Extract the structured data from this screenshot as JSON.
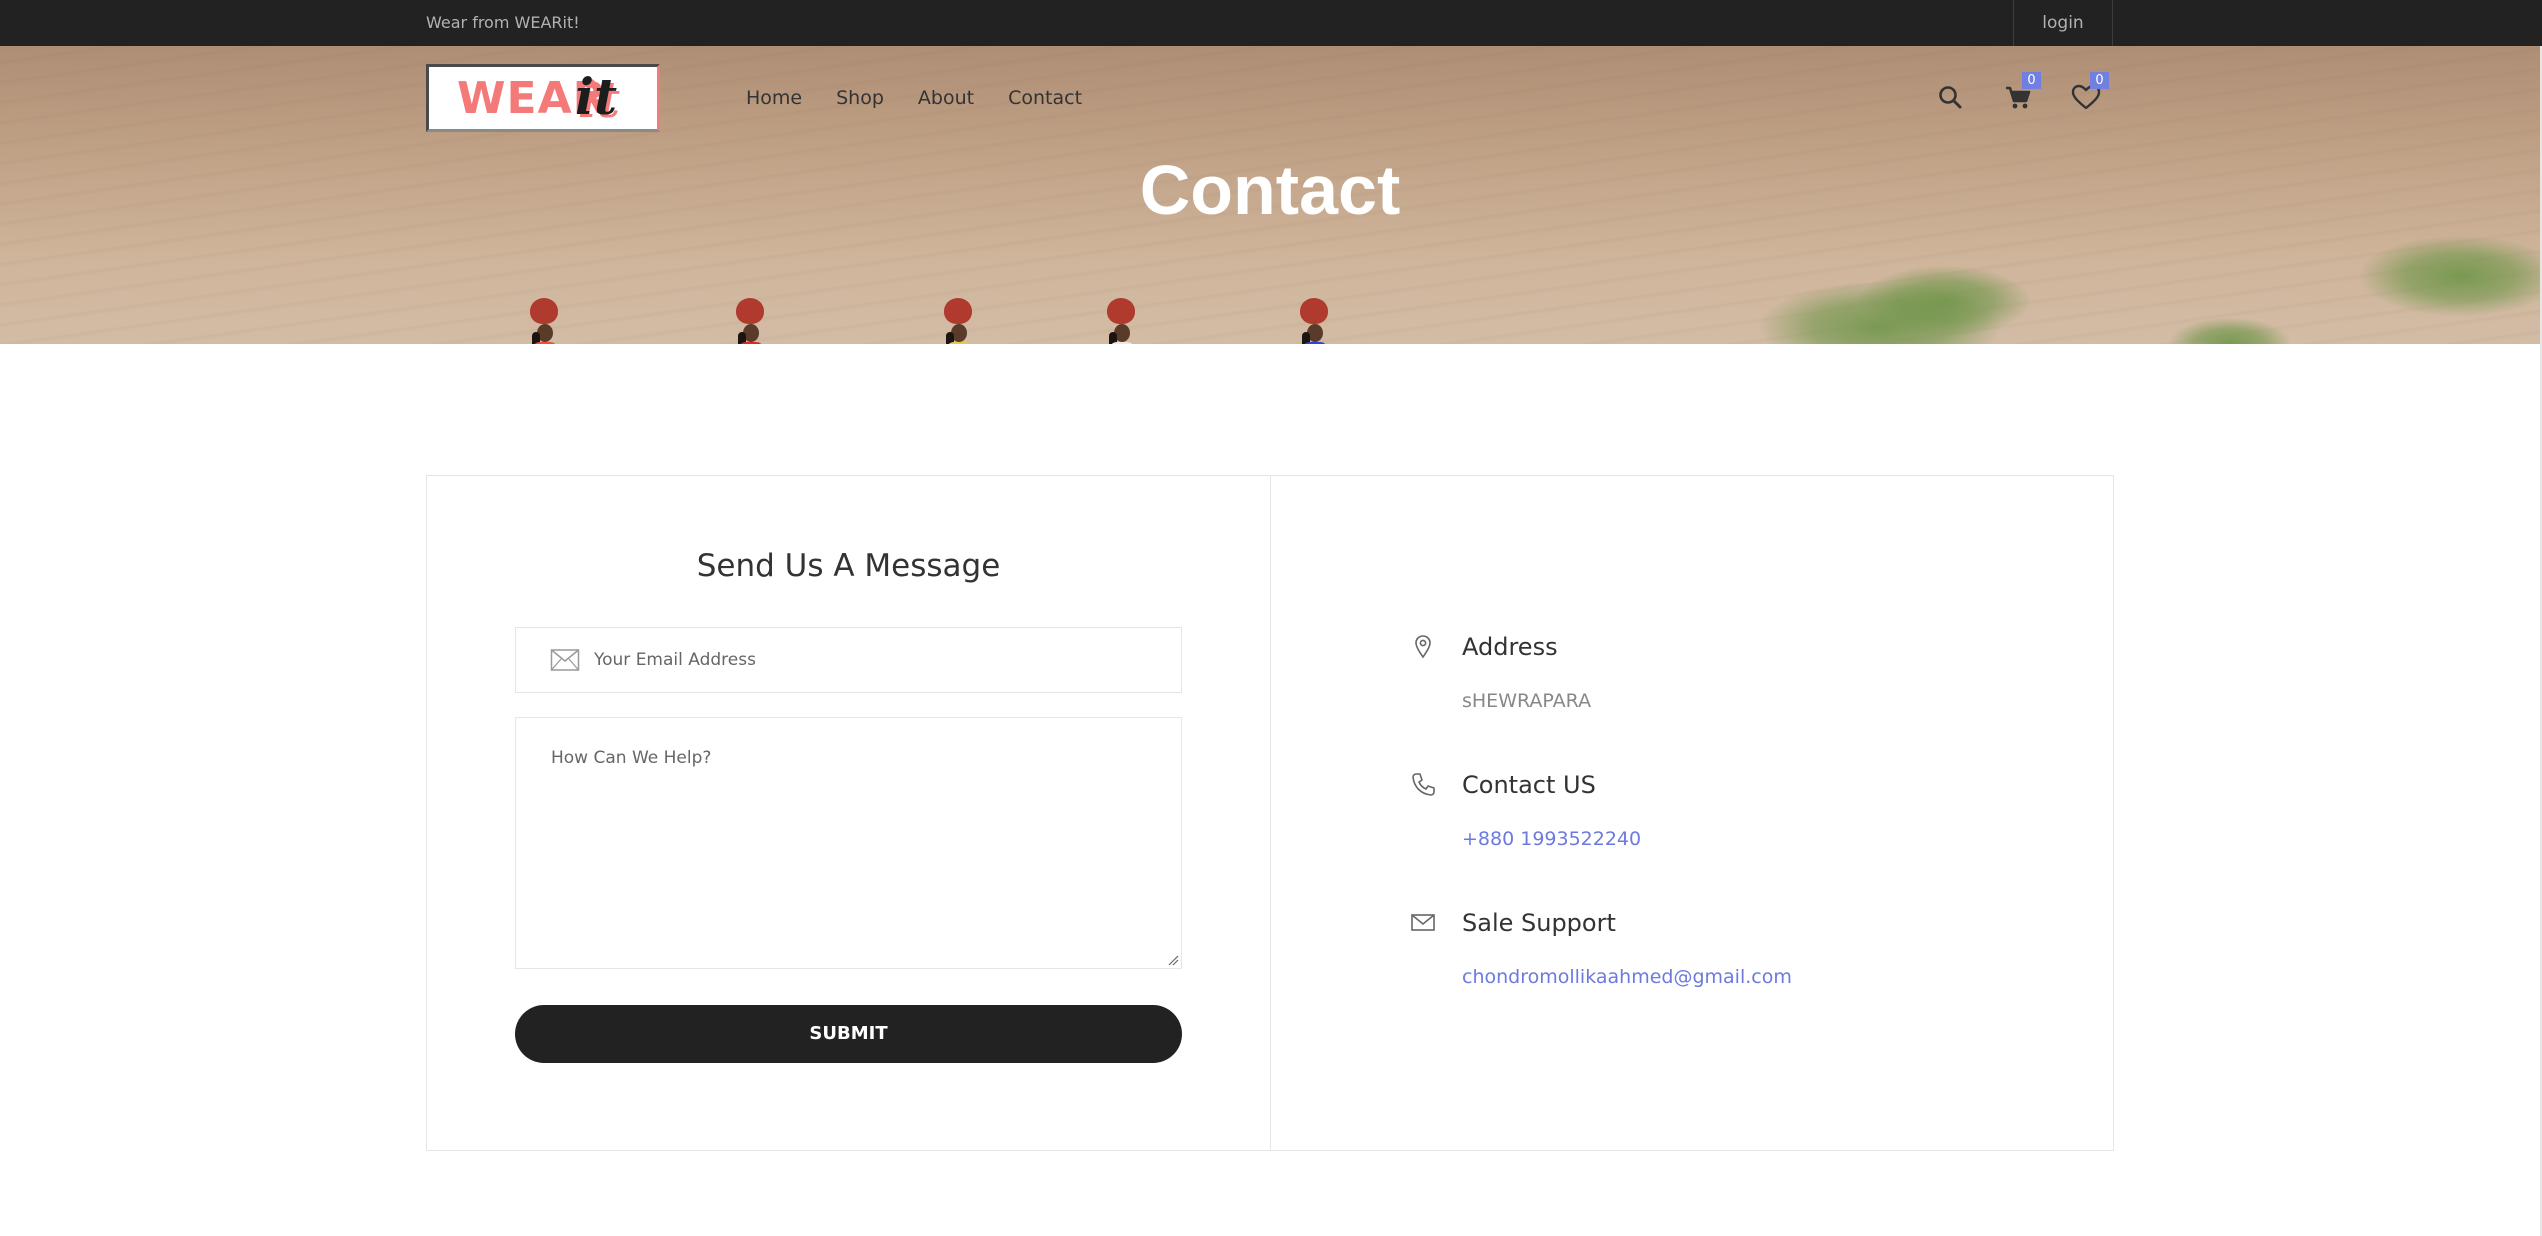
{
  "topbar": {
    "tagline": "Wear from WEARit!",
    "login": "login"
  },
  "header": {
    "logo_word": "WEAR",
    "logo_script": "it",
    "nav": [
      "Home",
      "Shop",
      "About",
      "Contact"
    ],
    "cart_count": "0",
    "wishlist_count": "0",
    "icons": [
      "search-icon",
      "cart-icon",
      "heart-icon"
    ]
  },
  "hero": {
    "title": "Contact"
  },
  "contact_form": {
    "title": "Send Us A Message",
    "email_placeholder": "Your Email Address",
    "message_placeholder": "How Can We Help?",
    "submit_label": "SUBMIT"
  },
  "contact_info": {
    "address_title": "Address",
    "address_text": "sHEWRAPARA",
    "phone_title": "Contact US",
    "phone": "+880 1993522240",
    "support_title": "Sale Support",
    "support_email": "chondromollikaahmed@gmail.com"
  },
  "colors": {
    "topbar": "#222222",
    "accent": "#717fe0",
    "link": "#6c7ae0",
    "logo_pink": "#f47a7a",
    "button": "#222222"
  }
}
